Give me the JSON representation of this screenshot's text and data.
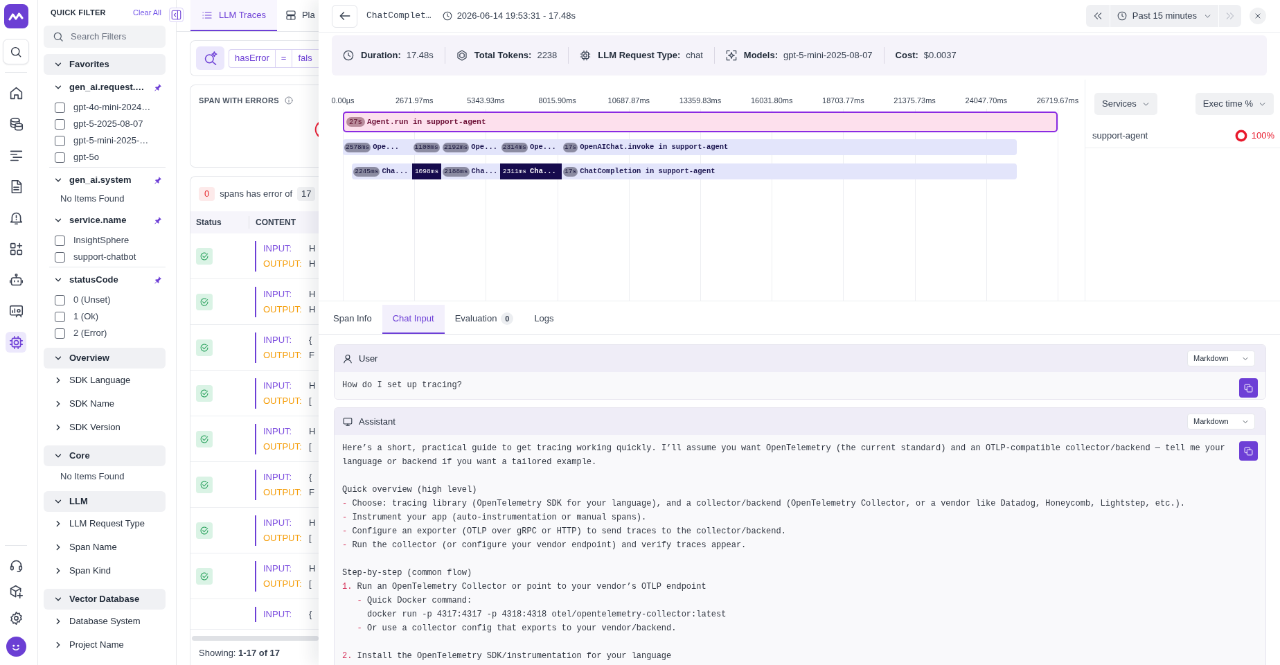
{
  "rail": {
    "items": [
      {
        "kind": "home",
        "selected": false
      },
      {
        "kind": "data",
        "selected": false
      },
      {
        "kind": "logs",
        "selected": false
      },
      {
        "kind": "document",
        "selected": false
      },
      {
        "kind": "alerts",
        "selected": false
      },
      {
        "kind": "dashboard",
        "selected": false
      },
      {
        "kind": "agent",
        "selected": false
      },
      {
        "kind": "user_monitor",
        "selected": false
      },
      {
        "kind": "llm",
        "selected": true
      }
    ],
    "bottom": [
      {
        "kind": "support",
        "selected": false
      },
      {
        "kind": "integrations",
        "selected": false
      },
      {
        "kind": "settings",
        "selected": false
      }
    ]
  },
  "quick_filter": {
    "title": "QUICK FILTER",
    "clear": "Clear All",
    "search_placeholder": "Search Filters",
    "groups": [
      {
        "title": "Favorites",
        "expanded": true,
        "sections": [
          {
            "title": "gen_ai.request.…",
            "pinned": true,
            "expanded": true,
            "options": [
              {
                "label": "gpt-4o-mini-2024…",
                "checked": false
              },
              {
                "label": "gpt-5-2025-08-07",
                "checked": false
              },
              {
                "label": "gpt-5-mini-2025-…",
                "checked": false
              },
              {
                "label": "gpt-5o",
                "checked": false
              }
            ]
          },
          {
            "title": "gen_ai.system",
            "pinned": true,
            "expanded": true,
            "empty_text": "No Items Found"
          },
          {
            "title": "service.name",
            "pinned": true,
            "expanded": true,
            "options": [
              {
                "label": "InsightSphere",
                "checked": false
              },
              {
                "label": "support-chatbot",
                "checked": false
              }
            ]
          },
          {
            "title": "statusCode",
            "pinned": true,
            "expanded": true,
            "options": [
              {
                "label": "0 (Unset)",
                "checked": false
              },
              {
                "label": "1 (Ok)",
                "checked": false
              },
              {
                "label": "2 (Error)",
                "checked": false
              }
            ]
          }
        ]
      },
      {
        "title": "Overview",
        "expanded": true,
        "sections": [
          {
            "title": "SDK Language",
            "expanded": false
          },
          {
            "title": "SDK Name",
            "expanded": false
          },
          {
            "title": "SDK Version",
            "expanded": false
          }
        ]
      },
      {
        "title": "Core",
        "expanded": true,
        "empty_text": "No Items Found"
      },
      {
        "title": "LLM",
        "expanded": true,
        "sections": [
          {
            "title": "LLM Request Type",
            "expanded": false
          },
          {
            "title": "Span Name",
            "expanded": false
          },
          {
            "title": "Span Kind",
            "expanded": false
          }
        ]
      },
      {
        "title": "Vector Database",
        "expanded": true,
        "sections": [
          {
            "title": "Database System",
            "expanded": false
          },
          {
            "title": "Project Name",
            "expanded": false
          }
        ]
      }
    ]
  },
  "traces": {
    "tabs": [
      {
        "kind": "list",
        "label": "LLM Traces",
        "selected": true
      },
      {
        "kind": "layout",
        "label": "Pla",
        "selected": false
      }
    ],
    "query": {
      "field": "hasError",
      "operator": "=",
      "value": "fals"
    },
    "errors_card": {
      "title": "SPAN WITH ERRORS"
    },
    "error_summary": {
      "count": "0",
      "text": "spans has error of",
      "total": "17"
    },
    "table": {
      "columns": [
        "Status",
        "CONTENT"
      ],
      "rows": [
        {
          "success": true,
          "lines": [
            {
              "kind": "input",
              "label": "INPUT:",
              "value": "H"
            },
            {
              "kind": "output",
              "label": "OUTPUT:",
              "value": "H"
            }
          ]
        },
        {
          "success": true,
          "lines": [
            {
              "kind": "input",
              "label": "INPUT:",
              "value": "H"
            },
            {
              "kind": "output",
              "label": "OUTPUT:",
              "value": "H"
            }
          ]
        },
        {
          "success": true,
          "lines": [
            {
              "kind": "input",
              "label": "INPUT:",
              "value": "{"
            },
            {
              "kind": "output",
              "label": "OUTPUT:",
              "value": "F"
            }
          ]
        },
        {
          "success": true,
          "lines": [
            {
              "kind": "input",
              "label": "INPUT:",
              "value": "H"
            },
            {
              "kind": "output",
              "label": "OUTPUT:",
              "value": "["
            }
          ]
        },
        {
          "success": true,
          "lines": [
            {
              "kind": "input",
              "label": "INPUT:",
              "value": "H"
            },
            {
              "kind": "output",
              "label": "OUTPUT:",
              "value": "["
            }
          ]
        },
        {
          "success": true,
          "lines": [
            {
              "kind": "input",
              "label": "INPUT:",
              "value": "{"
            },
            {
              "kind": "output",
              "label": "OUTPUT:",
              "value": "F"
            }
          ]
        },
        {
          "success": true,
          "lines": [
            {
              "kind": "input",
              "label": "INPUT:",
              "value": "H"
            },
            {
              "kind": "output",
              "label": "OUTPUT:",
              "value": "["
            }
          ]
        },
        {
          "success": true,
          "lines": [
            {
              "kind": "input",
              "label": "INPUT:",
              "value": "H"
            },
            {
              "kind": "output",
              "label": "OUTPUT:",
              "value": "["
            }
          ]
        },
        {
          "lines": [
            {
              "kind": "input",
              "label": "INPUT:",
              "value": "{"
            }
          ]
        }
      ]
    },
    "footer": "Showing: **1-17 of 17**"
  },
  "drawer": {
    "header": {
      "title": "ChatComplet…",
      "time": "2026-06-14 19:53:31 - 17.48s",
      "range": "Past 15 minutes",
      "prev_disabled": false,
      "next_disabled": true
    },
    "summary": [
      {
        "kind": "duration",
        "label": "Duration:",
        "value": "17.48s"
      },
      {
        "kind": "tokens",
        "label": "Total Tokens:",
        "value": "2238"
      },
      {
        "kind": "request_type",
        "label": "LLM Request Type:",
        "value": "chat"
      },
      {
        "kind": "models",
        "label": "Models:",
        "value": "gpt-5-mini-2025-08-07"
      },
      {
        "kind": "cost",
        "label": "Cost:",
        "value": "$0.0037"
      }
    ],
    "timeline": {
      "ticks": [
        "0.00µs",
        "2671.97ms",
        "5343.93ms",
        "8015.90ms",
        "10687.87ms",
        "13359.83ms",
        "16031.80ms",
        "18703.77ms",
        "21375.73ms",
        "24047.70ms",
        "26719.67ms"
      ],
      "rows": [
        {
          "kind": "agent",
          "spans": [
            {
              "duration": "27s",
              "label": "Agent.run in support-agent",
              "selected": false
            }
          ]
        },
        {
          "kind": "llm",
          "spans": [
            {
              "duration": "2578ms",
              "label": "Ope...",
              "selected": false
            },
            {
              "duration": "1100ms",
              "selected": false
            },
            {
              "duration": "2192ms",
              "label": "Ope...",
              "selected": false
            },
            {
              "duration": "2314ms",
              "label": "Ope...",
              "selected": false
            },
            {
              "duration": "17s",
              "label": "OpenAIChat.invoke in support-agent",
              "selected": false
            }
          ]
        },
        {
          "kind": "llm",
          "spans": [
            {
              "duration": "2245ms",
              "label": "Cha...",
              "selected": false
            },
            {
              "duration": "1098ms",
              "selected": true
            },
            {
              "duration": "2188ms",
              "label": "Cha...",
              "selected": false
            },
            {
              "duration": "2311ms",
              "label": "Cha...",
              "selected": true
            },
            {
              "duration": "17s",
              "label": "ChatCompletion in support-agent",
              "selected": false
            }
          ]
        }
      ]
    },
    "services": {
      "filters": [
        {
          "label": "Services"
        },
        {
          "label": "Exec time %"
        }
      ],
      "rows": [
        {
          "name": "support-agent",
          "share": "100%"
        }
      ]
    },
    "tabs": [
      {
        "label": "Span Info",
        "selected": false
      },
      {
        "label": "Chat Input",
        "selected": true
      },
      {
        "label": "Evaluation",
        "count": "0",
        "selected": false
      },
      {
        "label": "Logs",
        "selected": false
      }
    ],
    "messages": [
      {
        "kind": "user",
        "role": "User",
        "format": "Markdown",
        "sections": [
          {
            "text": "How do I set up tracing?"
          }
        ]
      },
      {
        "kind": "assistant",
        "role": "Assistant",
        "format": "Markdown",
        "sections": [
          {
            "text": "Here’s a short, practical guide to get tracing working quickly. I’ll assume you want OpenTelemetry (the current standard) and an OTLP-compatible collector/backend — tell me your language or backend if you want a tailored example."
          },
          {
            "text": "Quick overview (high level)",
            "items": [
              {
                "marker": "-",
                "text": "Choose: tracing library (OpenTelemetry SDK for your language), and a collector/backend (OpenTelemetry Collector, or a vendor like Datadog, Honeycomb, Lightstep, etc.)."
              },
              {
                "marker": "-",
                "text": "Instrument your app (auto-instrumentation or manual spans)."
              },
              {
                "marker": "-",
                "text": "Configure an exporter (OTLP over gRPC or HTTP) to send traces to the collector/backend."
              },
              {
                "marker": "-",
                "text": "Run the collector (or configure your vendor endpoint) and verify traces appear."
              }
            ]
          },
          {
            "text": "Step-by-step (common flow)",
            "items": [
              {
                "marker": "1.",
                "text": "Run an OpenTelemetry Collector or point to your vendor’s OTLP endpoint",
                "children": [
                  {
                    "marker": "-",
                    "text": "Quick Docker command:",
                    "children": [
                      {
                        "text": "docker run -p 4317:4317 -p 4318:4318 otel/opentelemetry-collector:latest"
                      }
                    ]
                  },
                  {
                    "marker": "-",
                    "text": "Or use a collector config that exports to your vendor/backend."
                  }
                ]
              }
            ]
          },
          {
            "items": [
              {
                "marker": "2.",
                "text": "Install the OpenTelemetry SDK/instrumentation for your language"
              }
            ]
          }
        ]
      }
    ]
  }
}
